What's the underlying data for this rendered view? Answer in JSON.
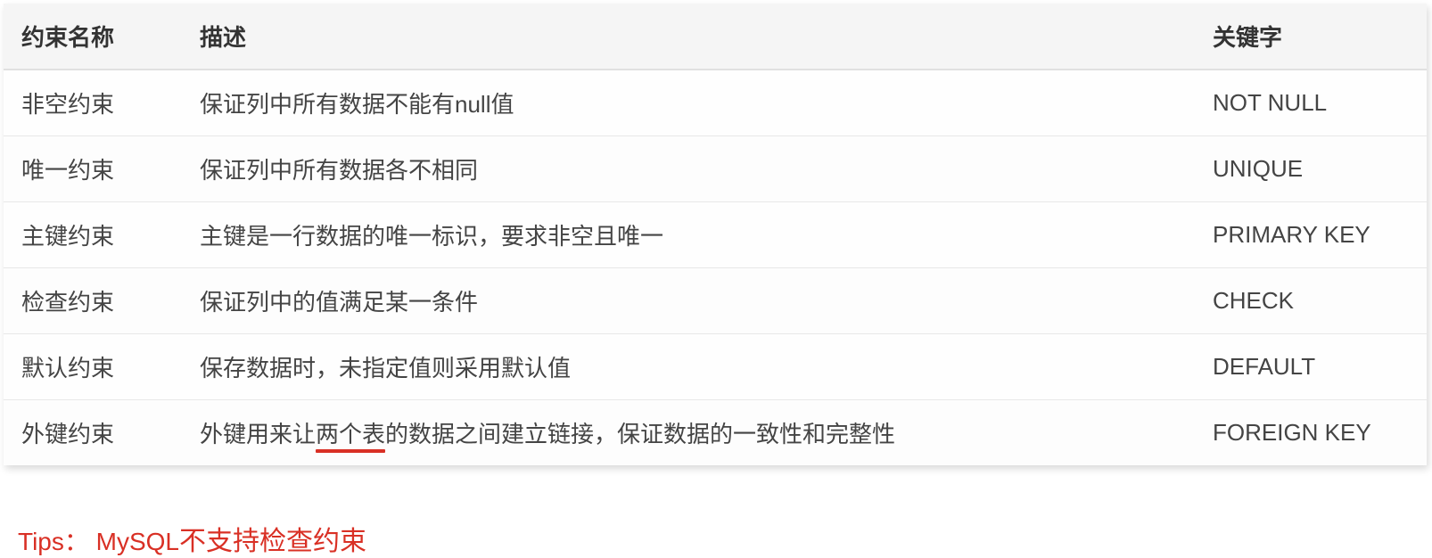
{
  "table": {
    "headers": {
      "name": "约束名称",
      "desc": "描述",
      "keyword": "关键字"
    },
    "rows": [
      {
        "name": "非空约束",
        "desc": "保证列中所有数据不能有null值",
        "keyword": "NOT NULL"
      },
      {
        "name": "唯一约束",
        "desc": "保证列中所有数据各不相同",
        "keyword": "UNIQUE"
      },
      {
        "name": "主键约束",
        "desc": "主键是一行数据的唯一标识，要求非空且唯一",
        "keyword": "PRIMARY KEY"
      },
      {
        "name": "检查约束",
        "desc": "保证列中的值满足某一条件",
        "keyword": "CHECK"
      },
      {
        "name": "默认约束",
        "desc": "保存数据时，未指定值则采用默认值",
        "keyword": "DEFAULT"
      },
      {
        "name": "外键约束",
        "desc_pre": "外键用来让",
        "desc_underlined": "两个表",
        "desc_post": "的数据之间建立链接，保证数据的一致性和完整性",
        "keyword": "FOREIGN KEY"
      }
    ]
  },
  "tips": {
    "prefix": "Tips： ",
    "main": "MySQL",
    "rest": "不支持检查约束"
  }
}
